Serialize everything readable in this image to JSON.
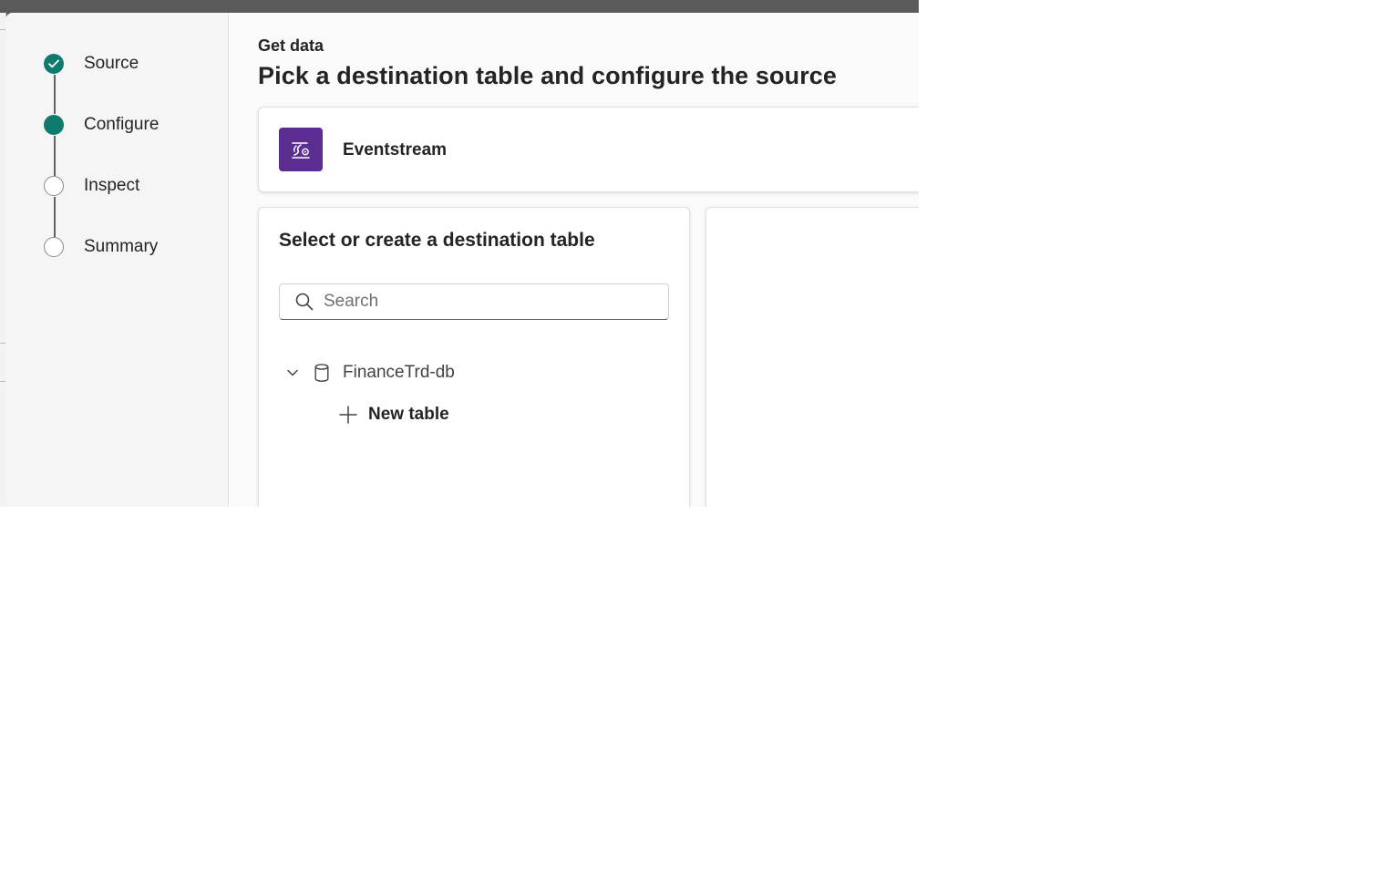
{
  "stepper": {
    "steps": [
      {
        "label": "Source",
        "state": "complete"
      },
      {
        "label": "Configure",
        "state": "current"
      },
      {
        "label": "Inspect",
        "state": "pending"
      },
      {
        "label": "Summary",
        "state": "pending"
      }
    ]
  },
  "header": {
    "eyebrow": "Get data",
    "title": "Pick a destination table and configure the source"
  },
  "source": {
    "name": "Eventstream",
    "icon": "eventstream-icon",
    "icon_color": "#5b2d91"
  },
  "destination": {
    "title": "Select or create a destination table",
    "search": {
      "placeholder": "Search",
      "value": ""
    },
    "database": {
      "name": "FinanceTrd-db",
      "expanded": true
    },
    "new_table_label": "New table"
  },
  "colors": {
    "accent": "#0f7b6c",
    "source_icon_bg": "#5b2d91"
  }
}
